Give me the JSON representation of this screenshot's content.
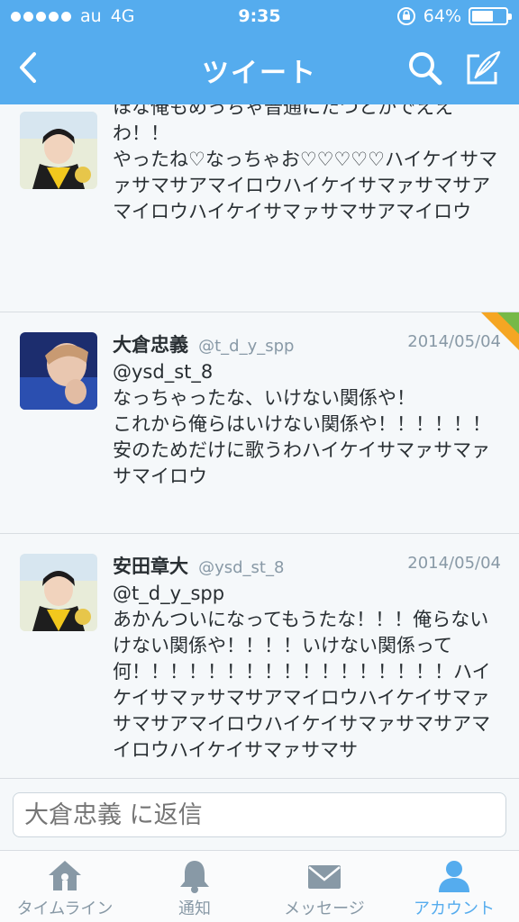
{
  "status_bar": {
    "carrier": "au",
    "network": "4G",
    "time": "9:35",
    "battery_percent": "64%",
    "battery_level": 0.64
  },
  "nav": {
    "title": "ツイート",
    "back_icon": "chevron-left-icon",
    "search_icon": "search-icon",
    "compose_icon": "compose-icon"
  },
  "tweets": [
    {
      "name": "",
      "handle": "",
      "date": "",
      "text": "@t_d_y_spp\nほな俺もめっちゃ普通にたつとかでええわ！！\nやったね♡なっちゃお♡♡♡♡♡ハイケイサマァサマサアマイロウハイケイサマァサマサアマイロウハイケイサマァサマサアマイロウ"
    },
    {
      "name": "大倉忠義",
      "handle": "@t_d_y_spp",
      "date": "2014/05/04",
      "text": "@ysd_st_8\nなっちゃったな、いけない関係や！\nこれから俺らはいけない関係や！！！！！！\n安のためだけに歌うわハイケイサマァサマァサマイロウ"
    },
    {
      "name": "安田章大",
      "handle": "@ysd_st_8",
      "date": "2014/05/04",
      "text": "@t_d_y_spp\nあかんついになってもうたな！！！俺らないけない関係や！！！！いけない関係って\n何！！！！！！！！！！！！！！！！！ハイケイサマァサマサアマイロウハイケイサマァサマサアマイロウハイケイサマァサマサアマイロウハイケイサマァサマサ"
    }
  ],
  "reply": {
    "placeholder": "大倉忠義 に返信"
  },
  "tabs": [
    {
      "label": "タイムライン",
      "icon": "home-icon"
    },
    {
      "label": "通知",
      "icon": "bell-icon"
    },
    {
      "label": "メッセージ",
      "icon": "envelope-icon"
    },
    {
      "label": "アカウント",
      "icon": "person-icon"
    }
  ],
  "colors": {
    "accent": "#55acee",
    "muted": "#8899a6"
  }
}
